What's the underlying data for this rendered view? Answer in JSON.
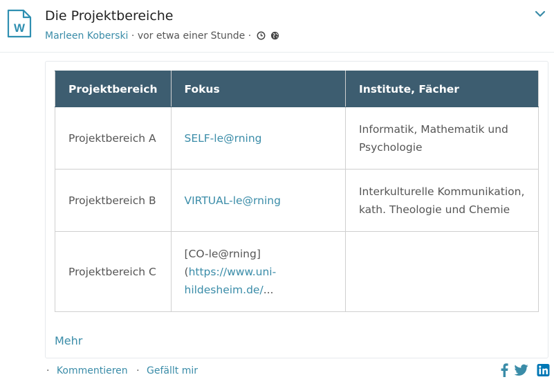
{
  "post": {
    "title": "Die Projektbereiche",
    "author": "Marleen Koberski",
    "time": "vor etwa einer Stunde",
    "separator": "·",
    "doc_icon_letter": "W"
  },
  "table": {
    "headers": [
      "Projektbereich",
      "Fokus",
      "Institute, Fächer"
    ],
    "rows": [
      {
        "area": "Projektbereich A",
        "focus_link": "SELF-le@rning",
        "institutes": "Informatik, Mathematik und Psychologie"
      },
      {
        "area": "Projektbereich B",
        "focus_link": "VIRTUAL-le@rning",
        "institutes": "Interkulturelle Kommunikation, kath. Theologie und Chemie"
      },
      {
        "area": "Projektbereich C",
        "focus_prefix": "[CO-le@rning] (",
        "focus_link": "https://www.uni-hildesheim.de/",
        "focus_suffix": "...",
        "institutes": ""
      }
    ]
  },
  "more_label": "Mehr",
  "actions": {
    "separator": "·",
    "comment": "Kommentieren",
    "like": "Gefällt mir"
  },
  "share_icons": [
    "facebook-icon",
    "twitter-icon",
    "linkedin-icon"
  ],
  "colors": {
    "link": "#3a8ca8",
    "table_header": "#3d5d70",
    "doc_icon": "#2f8fb1",
    "linkedin": "#0077b5"
  }
}
